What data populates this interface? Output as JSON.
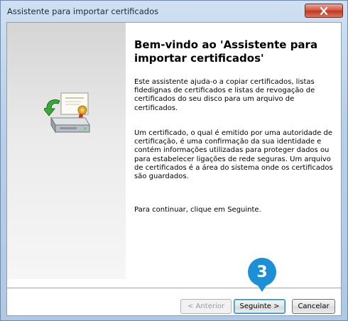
{
  "window": {
    "title": "Assistente para importar certificados"
  },
  "wizard": {
    "heading": "Bem-vindo ao 'Assistente para importar certificados'",
    "paragraph1": "Este assistente ajuda-o a copiar certificados, listas fidedignas de certificados e listas de revogação de certificados do seu disco para um arquivo de certificados.",
    "paragraph2": "Um certificado, o qual é emitido por uma autoridade de certificação, é uma confirmação da sua identidade e contém informações utilizadas para proteger dados ou para estabelecer ligações de rede seguras. Um arquivo de certificados é a área do sistema onde os certificados são guardados.",
    "paragraph3": "Para continuar, clique em Seguinte."
  },
  "buttons": {
    "back": "< Anterior",
    "next": "Seguinte >",
    "cancel": "Cancelar"
  },
  "annotation": {
    "step": "3"
  },
  "colors": {
    "badge": "#1d8fd6",
    "close_button": "#c23720"
  },
  "icons": [
    "close-icon",
    "certificate-import-icon"
  ]
}
